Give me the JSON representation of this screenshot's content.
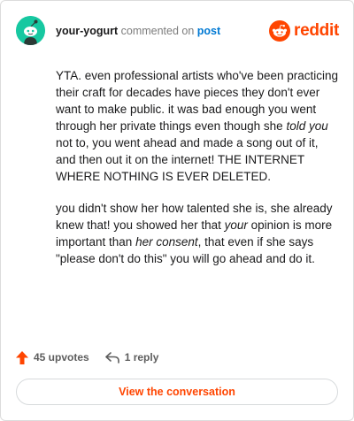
{
  "header": {
    "username": "your-yogurt",
    "verb": " commented on ",
    "post_link": "post",
    "brand_word": "reddit",
    "avatar_icon": "snoo-avatar-icon",
    "brand_icon": "reddit-logo-icon"
  },
  "comment": {
    "p1_a": "YTA. even professional artists who've been practicing their craft for decades have pieces they don't ever want to make public. it was bad enough you went through her private things even though she ",
    "p1_em": "told you",
    "p1_b": " not to, you went ahead and made a song out of it, and then out it on the internet! THE INTERNET WHERE NOTHING IS EVER DELETED.",
    "p2_a": "you didn't show her how talented she is, she already knew that! you showed her that ",
    "p2_em1": "your",
    "p2_b": " opinion is more important than ",
    "p2_em2": "her consent",
    "p2_c": ", that even if she says \"please don't do this\" you will go ahead and do it."
  },
  "actions": {
    "upvotes": "45 upvotes",
    "replies": "1 reply",
    "upvote_icon": "upvote-arrow-icon",
    "reply_icon": "reply-arrow-icon"
  },
  "cta": {
    "label": "View the conversation"
  },
  "colors": {
    "accent": "#ff4500",
    "link": "#0079d3",
    "avatar_bg": "#17c8a1"
  }
}
